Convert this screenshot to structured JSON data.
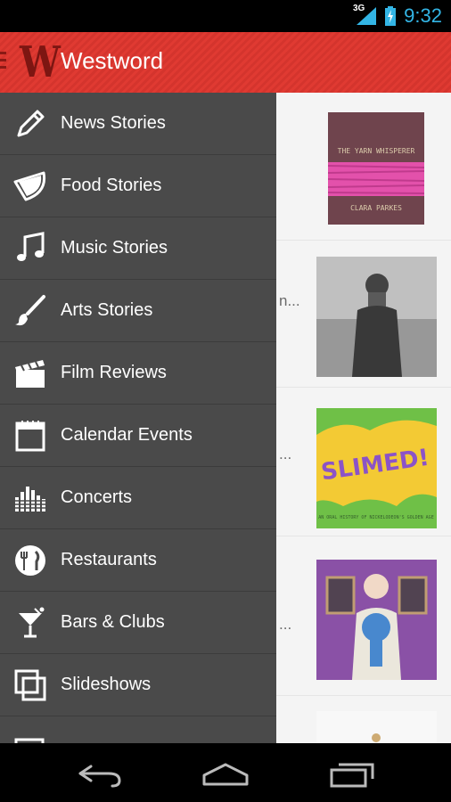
{
  "status": {
    "network": "3G",
    "time": "9:32",
    "accent": "#33b5e5"
  },
  "app": {
    "logo": "W",
    "title": "Westword",
    "brand_color": "#e03a32"
  },
  "drawer": {
    "items": [
      {
        "label": "News Stories",
        "icon": "pencil-icon"
      },
      {
        "label": "Food Stories",
        "icon": "watermelon-icon"
      },
      {
        "label": "Music Stories",
        "icon": "music-note-icon"
      },
      {
        "label": "Arts Stories",
        "icon": "paintbrush-icon"
      },
      {
        "label": "Film Reviews",
        "icon": "clapperboard-icon"
      },
      {
        "label": "Calendar Events",
        "icon": "calendar-icon"
      },
      {
        "label": "Concerts",
        "icon": "equalizer-icon"
      },
      {
        "label": "Restaurants",
        "icon": "fork-knife-icon"
      },
      {
        "label": "Bars & Clubs",
        "icon": "cocktail-icon"
      },
      {
        "label": "Slideshows",
        "icon": "slideshow-icon"
      }
    ]
  },
  "content": {
    "thumbs": [
      {
        "text_top": "THE YARN WHISPERER",
        "text_bottom": "CLARA PARKES"
      },
      {
        "text_top": ""
      },
      {
        "text_top": "SLIMED!",
        "text_bottom": "AN ORAL HISTORY OF NICKELODEON'S GOLDEN AGE"
      },
      {
        "text_top": ""
      }
    ],
    "ellipses": [
      "n...",
      "...",
      "..."
    ]
  },
  "nav": {
    "back": "back-icon",
    "home": "home-icon",
    "recents": "recents-icon"
  }
}
